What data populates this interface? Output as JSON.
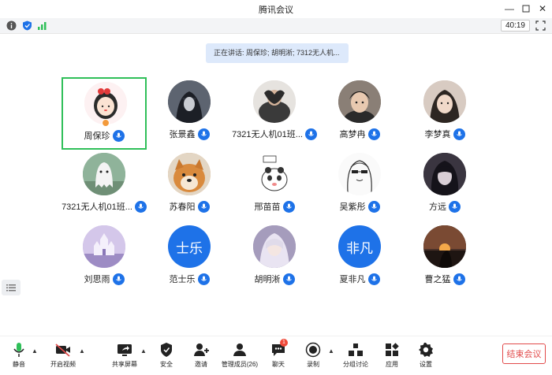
{
  "window": {
    "title": "腾讯会议"
  },
  "status": {
    "timer": "40:19"
  },
  "speaking": {
    "text": "正在讲话: 周保珍; 胡明淅; 7312无人机..."
  },
  "participants": [
    {
      "name": "周保珍",
      "avatar": "cartoon-girl",
      "active": true,
      "host": true
    },
    {
      "name": "张景鑫",
      "avatar": "anime-dark"
    },
    {
      "name": "7321无人机01班...",
      "avatar": "hands-heart"
    },
    {
      "name": "高梦冉",
      "avatar": "kid-photo"
    },
    {
      "name": "李梦真",
      "avatar": "girl-photo"
    },
    {
      "name": "7321无人机01班...",
      "avatar": "ghost"
    },
    {
      "name": "苏春阳",
      "avatar": "shiba-dog"
    },
    {
      "name": "邢苗苗",
      "avatar": "panda-meme"
    },
    {
      "name": "吴紫彤",
      "avatar": "sketch-girl"
    },
    {
      "name": "方远",
      "avatar": "dark-anime"
    },
    {
      "name": "刘思雨",
      "avatar": "purple-castle"
    },
    {
      "name": "范士乐",
      "avatar_text": "士乐"
    },
    {
      "name": "胡明淅",
      "avatar": "anime-lady"
    },
    {
      "name": "夏非凡",
      "avatar_text": "非凡"
    },
    {
      "name": "曹之猛",
      "avatar": "sunset"
    }
  ],
  "toolbar": {
    "mute": "静音",
    "video": "开启视频",
    "share": "共享屏幕",
    "security": "安全",
    "invite": "邀请",
    "members": "管理成员(26)",
    "chat": "聊天",
    "chat_badge": "1",
    "record": "录制",
    "breakout": "分组讨论",
    "apps": "应用",
    "settings": "设置",
    "end": "结束会议"
  },
  "colors": {
    "accent": "#1e72e8",
    "active_border": "#2fbf59",
    "danger": "#e24b4b"
  }
}
